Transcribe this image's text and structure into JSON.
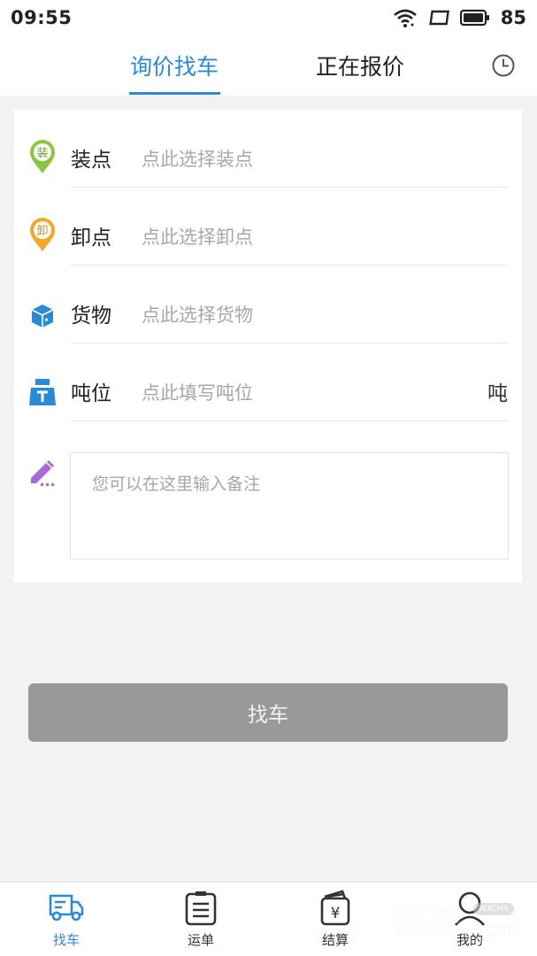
{
  "status_bar": {
    "time": "09:55",
    "battery": "85"
  },
  "header": {
    "tabs": [
      {
        "label": "询价找车",
        "active": true
      },
      {
        "label": "正在报价",
        "active": false
      }
    ]
  },
  "form": {
    "rows": [
      {
        "icon": "green-location-pin-icon",
        "badge": "装",
        "label": "装点",
        "placeholder": "点此选择装点"
      },
      {
        "icon": "orange-location-pin-icon",
        "badge": "卸",
        "label": "卸点",
        "placeholder": "点此选择卸点"
      },
      {
        "icon": "cargo-box-icon",
        "label": "货物",
        "placeholder": "点此选择货物"
      },
      {
        "icon": "weight-icon",
        "label": "吨位",
        "placeholder": "点此填写吨位",
        "unit": "吨"
      }
    ],
    "remark_placeholder": "您可以在这里输入备注"
  },
  "submit": {
    "label": "找车"
  },
  "bottom_nav": [
    {
      "label": "找车",
      "icon": "truck-icon",
      "active": true
    },
    {
      "label": "运单",
      "icon": "clipboard-icon",
      "active": false
    },
    {
      "label": "结算",
      "icon": "wallet-icon",
      "active": false
    },
    {
      "label": "我的",
      "icon": "user-icon",
      "active": false
    }
  ],
  "watermark": {
    "text": "微茶",
    "badge": "WXCHA",
    "suffix": ".com"
  },
  "colors": {
    "accent": "#2b8ad8",
    "pin_green": "#8cc63f",
    "pin_orange": "#f5a623",
    "pencil_purple": "#a66ad9",
    "button_disabled": "#999999"
  }
}
